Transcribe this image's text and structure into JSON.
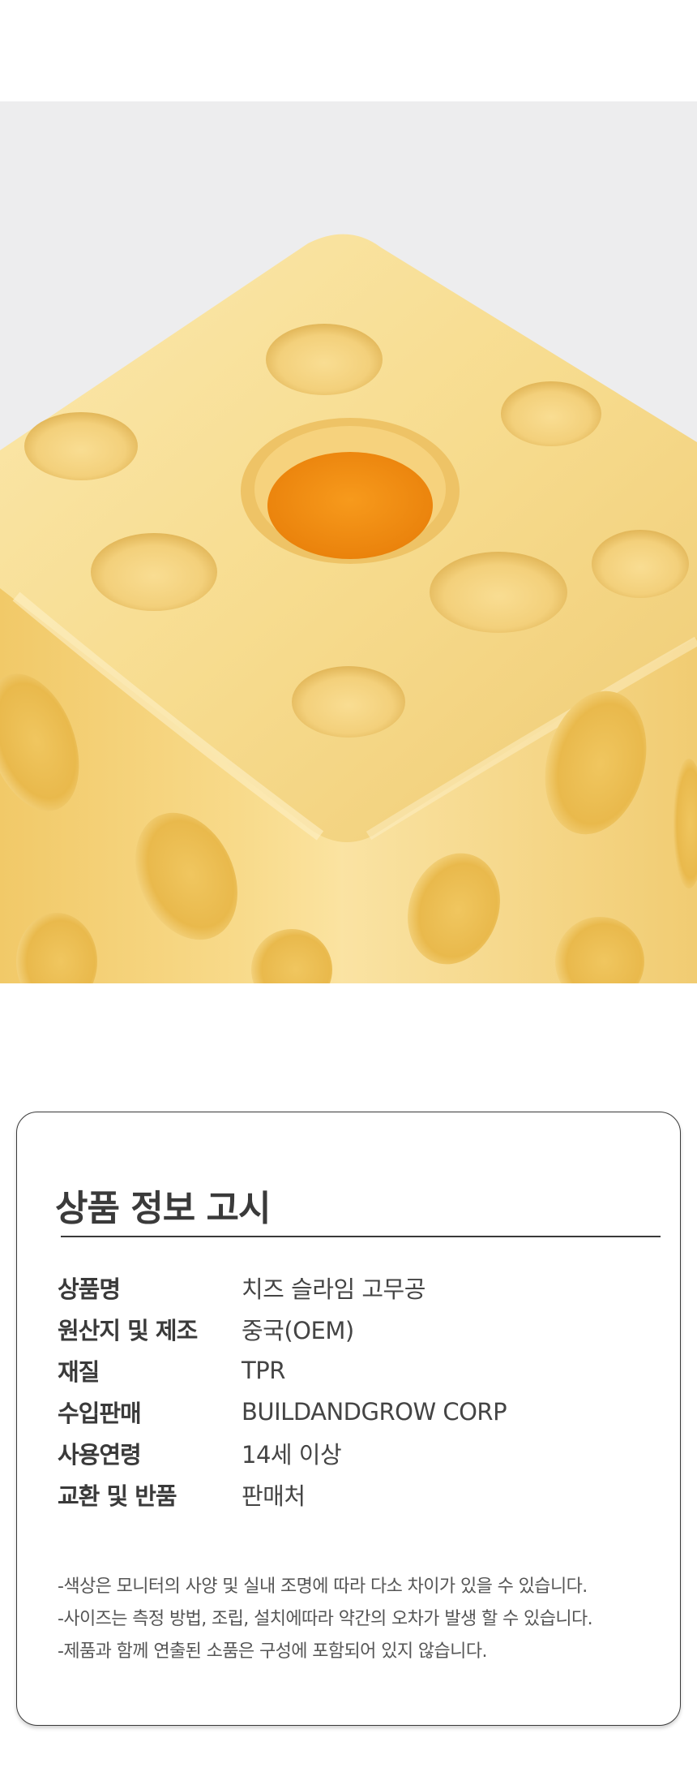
{
  "product_photo": {
    "subject": "cheese-cube-slime-ball-image"
  },
  "notice": {
    "title": "상품 정보 고시",
    "specs": [
      {
        "label": "상품명",
        "value": "치즈 슬라임 고무공"
      },
      {
        "label": "원산지 및 제조",
        "value": "중국(OEM)"
      },
      {
        "label": "재질",
        "value": "TPR"
      },
      {
        "label": "수입판매",
        "value": "BUILDANDGROW CORP"
      },
      {
        "label": "사용연령",
        "value": "14세 이상"
      },
      {
        "label": "교환 및 반품",
        "value": "판매처"
      }
    ],
    "notes": [
      "-색상은 모니터의 사양 및 실내 조명에 따라 다소 차이가 있을 수 있습니다.",
      "-사이즈는 측정 방법, 조립, 설치에따라 약간의 오차가 발생 할 수 있습니다.",
      "-제품과 함께 연출된 소품은 구성에 포함되어 있지 않습니다."
    ]
  },
  "colors": {
    "cheese": "#f5d27a",
    "cheese_light": "#fbe6a8",
    "cheese_shadow": "#e3b552",
    "orange_core": "#f08a0a",
    "border": "#3a3a3a"
  }
}
